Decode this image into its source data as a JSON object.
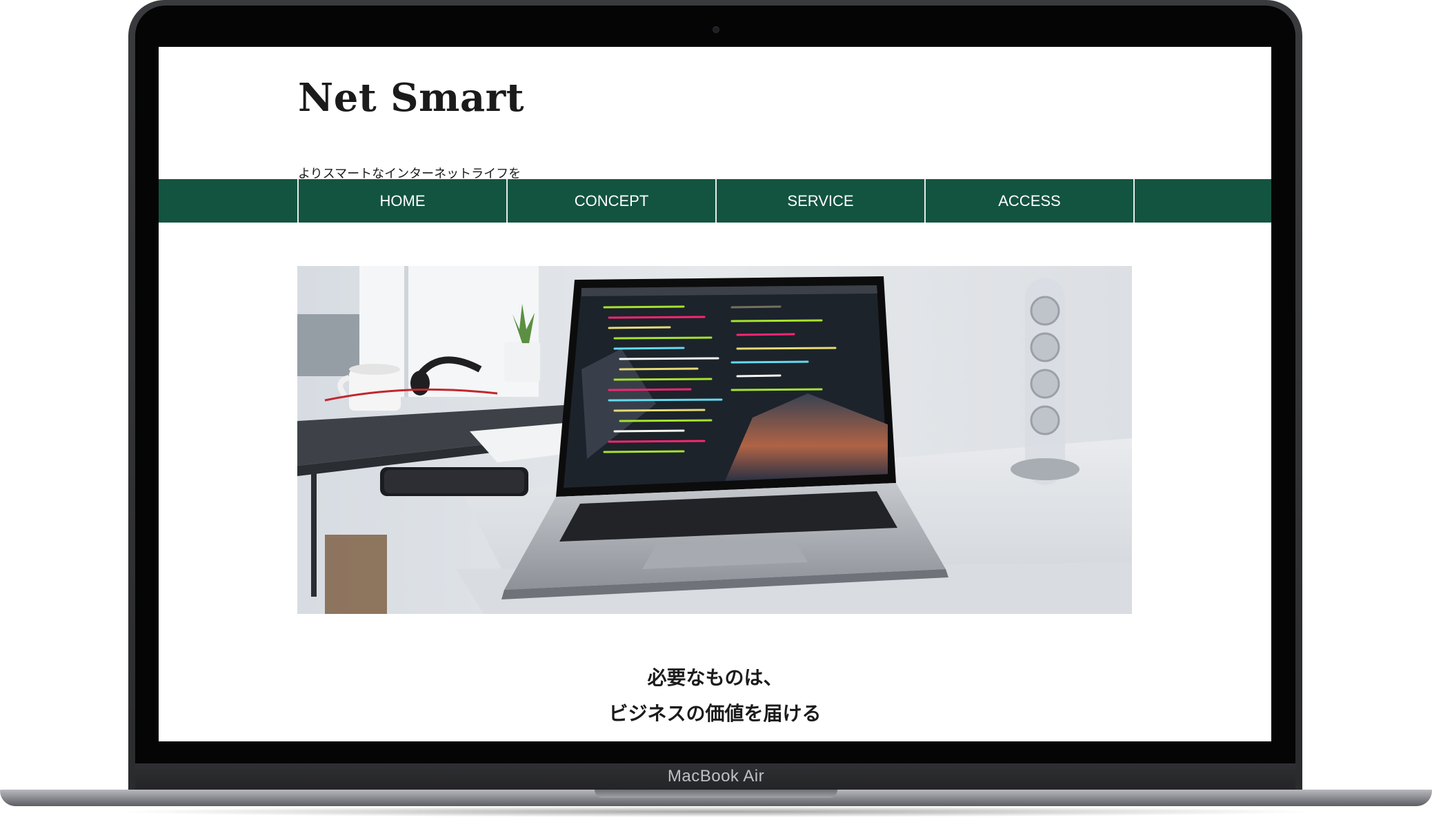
{
  "site": {
    "title": "Net Smart",
    "tagline": "よりスマートなインターネットライフを"
  },
  "nav": {
    "items": [
      "HOME",
      "CONCEPT",
      "SERVICE",
      "ACCESS"
    ]
  },
  "hero": {
    "icon": "laptop-on-desk-photo"
  },
  "headline": {
    "line1": "必要なものは、",
    "line2": "ビジネスの価値を届ける"
  },
  "device": {
    "label": "MacBook Air"
  },
  "colors": {
    "nav_background": "#135440",
    "text": "#1b1b1b"
  }
}
